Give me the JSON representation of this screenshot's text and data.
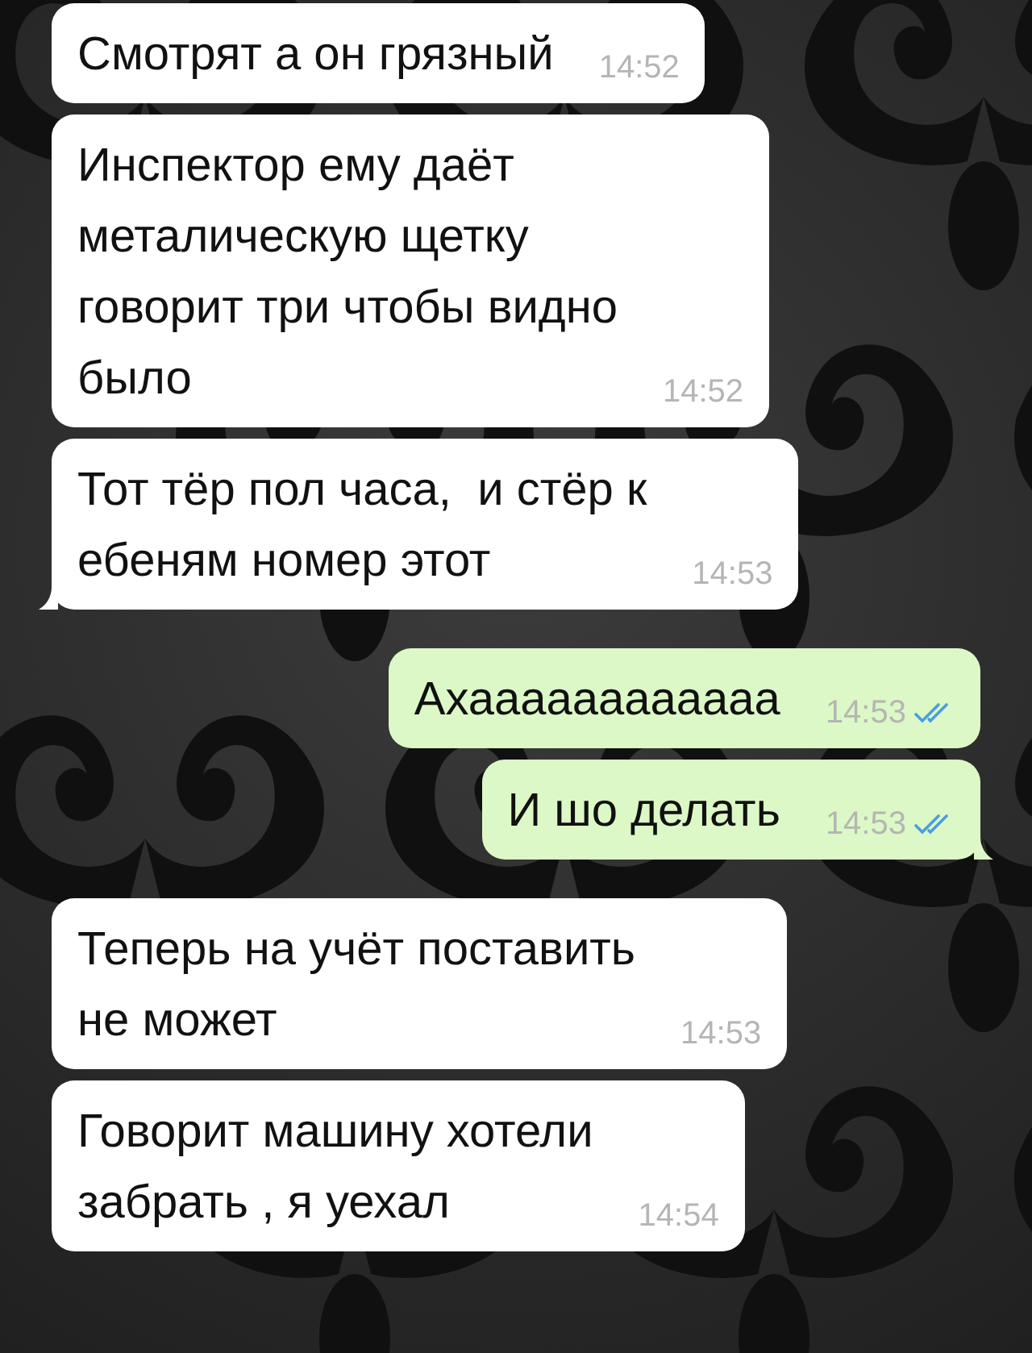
{
  "messages": [
    {
      "text": "Смотрят а он грязный",
      "time": "14:52",
      "outgoing": false,
      "tail": false
    },
    {
      "text": "Инспектор ему даёт\nметалическую щетку\nговорит три чтобы видно\nбыло",
      "time": "14:52",
      "outgoing": false,
      "tail": false
    },
    {
      "text": "Тот тёр пол часа,  и стёр к\nебеням номер этот",
      "time": "14:53",
      "outgoing": false,
      "tail": true
    },
    {
      "text": "Ахааааааааааaa",
      "time": "14:53",
      "outgoing": true,
      "tail": false,
      "read": true
    },
    {
      "text": "И шо делать",
      "time": "14:53",
      "outgoing": true,
      "tail": true,
      "read": true
    },
    {
      "text": "Теперь на учёт поставить\nне может",
      "time": "14:53",
      "outgoing": false,
      "tail": false
    },
    {
      "text": "Говорит машину хотели\nзабрать , я уехал",
      "time": "14:54",
      "outgoing": false,
      "tail": false
    }
  ]
}
